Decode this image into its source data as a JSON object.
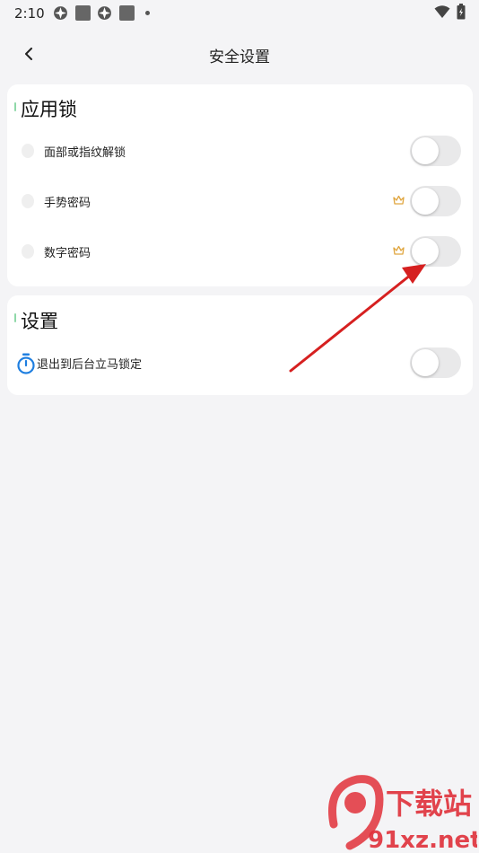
{
  "status_bar": {
    "time": "2:10",
    "icons": [
      "app-icon",
      "square-icon",
      "app-icon",
      "square-icon",
      "dot-icon",
      "wifi-icon",
      "battery-icon"
    ]
  },
  "header": {
    "back_icon": "back-icon",
    "title": "安全设置"
  },
  "app_lock": {
    "title": "应用锁",
    "items": [
      {
        "label": "面部或指纹解锁",
        "icon": "fingerprint-icon",
        "premium": false,
        "enabled": false
      },
      {
        "label": "手势密码",
        "icon": "fingerprint-icon",
        "premium": true,
        "enabled": false
      },
      {
        "label": "数字密码",
        "icon": "fingerprint-icon",
        "premium": true,
        "enabled": false
      }
    ]
  },
  "settings": {
    "title": "设置",
    "items": [
      {
        "label": "退出到后台立马锁定",
        "icon": "timer-icon",
        "enabled": false
      }
    ]
  },
  "colors": {
    "background": "#f4f4f6",
    "card": "#ffffff",
    "toggle_off": "#e9e9ea",
    "section_accent": "#8fd8a8",
    "timer_blue": "#1f7fe0",
    "crown_gold": "#e0a640",
    "annotation_arrow": "#d62020",
    "watermark_red": "#e0303a"
  },
  "watermark": {
    "logo_mark": "9",
    "name": "下载站",
    "domain": "91xz.net"
  }
}
